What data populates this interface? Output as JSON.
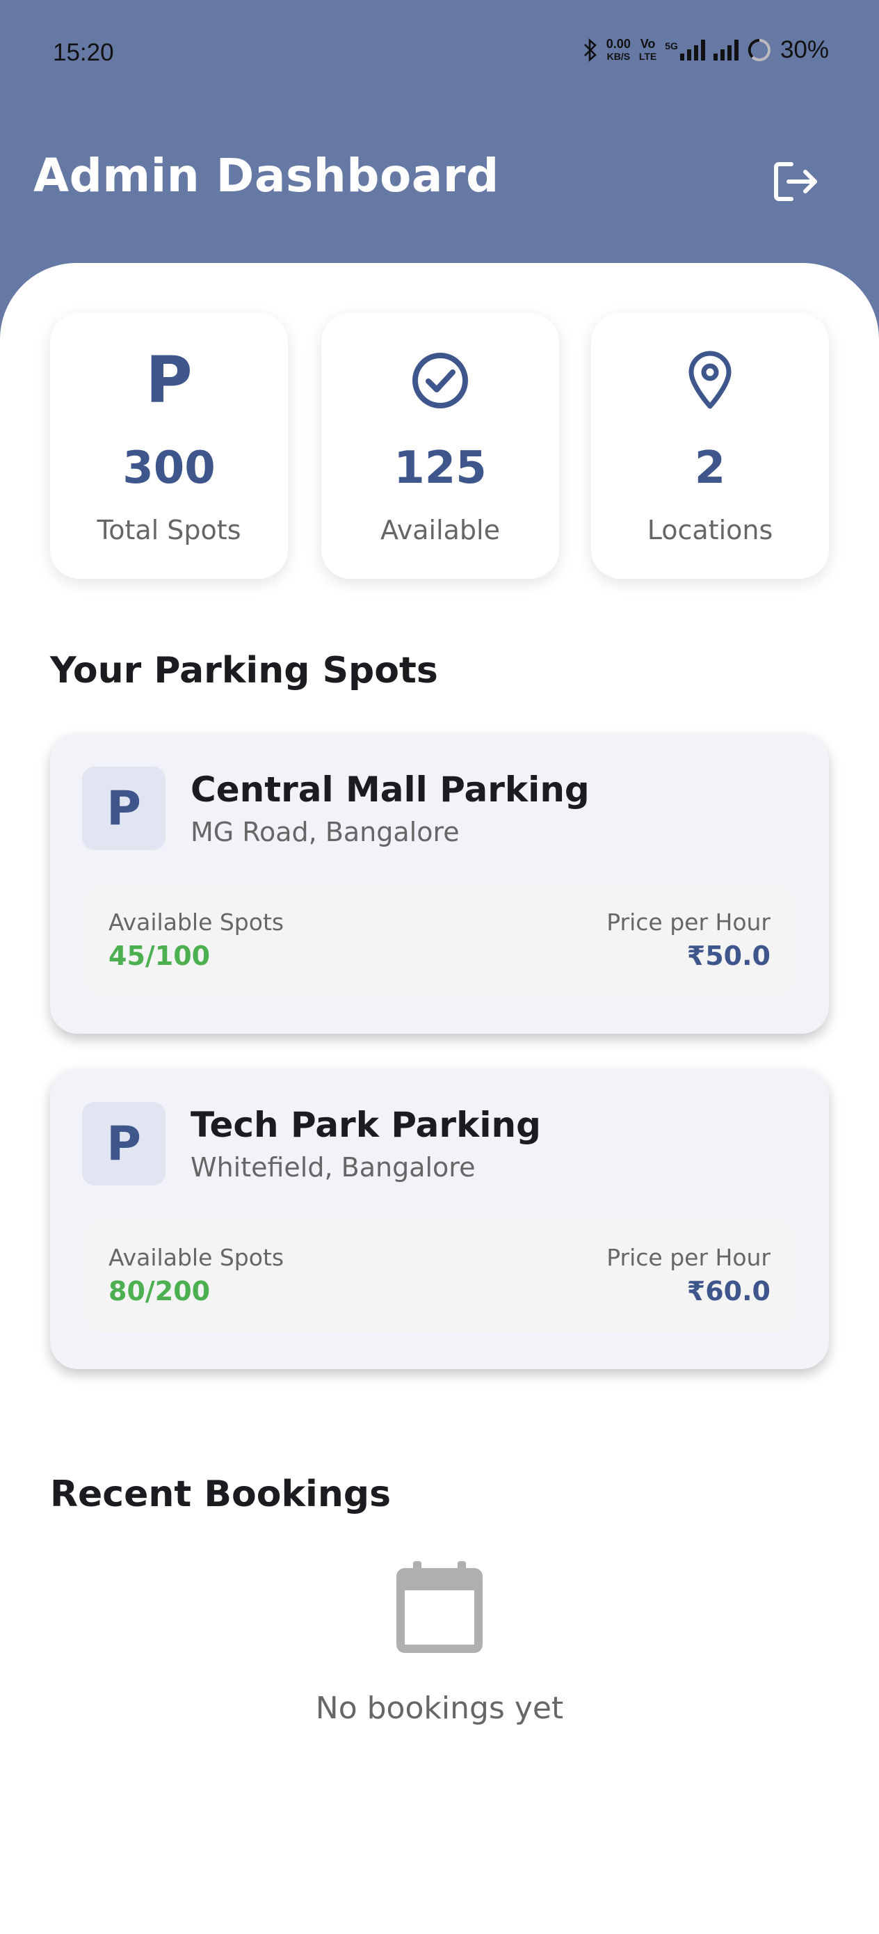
{
  "status_bar": {
    "time": "15:20",
    "net_speed_value": "0.00",
    "net_speed_unit": "KB/S",
    "volte_top": "Vo",
    "volte_bottom": "LTE",
    "network_type": "5G",
    "battery": "30%"
  },
  "header": {
    "title": "Admin Dashboard",
    "logout_icon": "logout-icon"
  },
  "stats": [
    {
      "icon": "parking-icon",
      "icon_glyph": "P",
      "value": "300",
      "label": "Total Spots"
    },
    {
      "icon": "check-circle-icon",
      "value": "125",
      "label": "Available"
    },
    {
      "icon": "location-pin-icon",
      "value": "2",
      "label": "Locations"
    }
  ],
  "parking_section": {
    "title": "Your Parking Spots",
    "spots": [
      {
        "badge": "P",
        "name": "Central Mall Parking",
        "address": "MG Road, Bangalore",
        "available_label": "Available Spots",
        "available_value": "45/100",
        "price_label": "Price per Hour",
        "price_value": "₹50.0"
      },
      {
        "badge": "P",
        "name": "Tech Park Parking",
        "address": "Whitefield, Bangalore",
        "available_label": "Available Spots",
        "available_value": "80/200",
        "price_label": "Price per Hour",
        "price_value": "₹60.0"
      }
    ]
  },
  "bookings_section": {
    "title": "Recent Bookings",
    "empty_icon": "calendar-icon",
    "empty_text": "No bookings yet"
  },
  "colors": {
    "header_bg": "#6679a5",
    "accent": "#3f568c",
    "available_green": "#4caf50",
    "card_bg": "#f2f3f8"
  }
}
